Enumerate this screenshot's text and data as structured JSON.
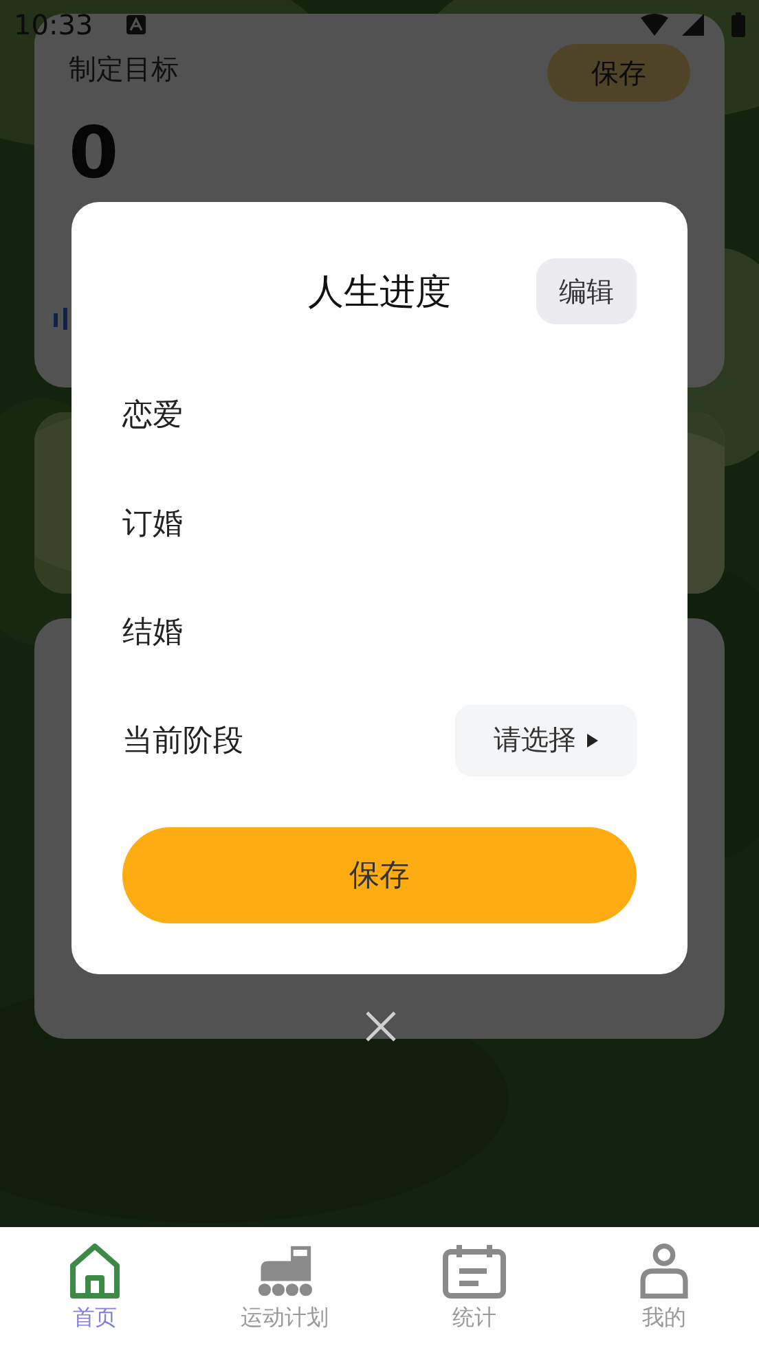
{
  "status_bar": {
    "time": "10:33"
  },
  "goal_card": {
    "title": "制定目标",
    "save_button": "保存",
    "value": "0"
  },
  "dialog": {
    "title": "人生进度",
    "edit_button": "编辑",
    "stages": [
      {
        "label": "恋爱"
      },
      {
        "label": "订婚"
      },
      {
        "label": "结婚"
      }
    ],
    "current_stage": {
      "label": "当前阶段",
      "placeholder": "请选择"
    },
    "save_button": "保存"
  },
  "tabs": [
    {
      "label": "首页",
      "selected": true
    },
    {
      "label": "运动计划",
      "selected": false
    },
    {
      "label": "统计",
      "selected": false
    },
    {
      "label": "我的",
      "selected": false
    }
  ]
}
